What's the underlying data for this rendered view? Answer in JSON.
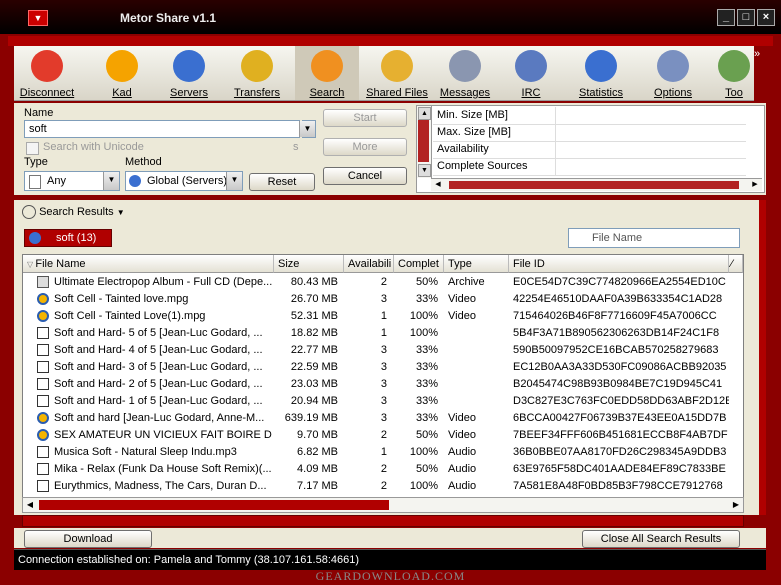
{
  "window": {
    "title": "Metor Share v1.1",
    "minimize": "_",
    "maximize": "□",
    "close": "×",
    "app_icon": "▼"
  },
  "toolbar": {
    "buttons": [
      {
        "label": "Disconnect",
        "icon": "disconnect-icon",
        "color": "#e23b2b"
      },
      {
        "label": "Kad",
        "icon": "kad-icon",
        "color": "#f5a300"
      },
      {
        "label": "Servers",
        "icon": "servers-icon",
        "color": "#3a6fd0"
      },
      {
        "label": "Transfers",
        "icon": "transfers-icon",
        "color": "#e0b020"
      },
      {
        "label": "Search",
        "icon": "search-icon",
        "color": "#f09020"
      },
      {
        "label": "Shared Files",
        "icon": "shared-files-icon",
        "color": "#e6b030"
      },
      {
        "label": "Messages",
        "icon": "messages-icon",
        "color": "#8a96b0"
      },
      {
        "label": "IRC",
        "icon": "irc-icon",
        "color": "#5a7ac0"
      },
      {
        "label": "Statistics",
        "icon": "statistics-icon",
        "color": "#3a6fd0"
      },
      {
        "label": "Options",
        "icon": "options-icon",
        "color": "#7a90c0"
      },
      {
        "label": "Too",
        "icon": "tools-icon",
        "color": "#6aa050"
      }
    ],
    "more": "»"
  },
  "search": {
    "name_label": "Name",
    "name_value": "soft",
    "unicode_label": "Search with Unicode",
    "unicode_suffix": "s",
    "type_label": "Type",
    "type_value": "Any",
    "method_label": "Method",
    "method_value": "Global (Servers)",
    "start_label": "Start",
    "more_label": "More",
    "cancel_label": "Cancel",
    "reset_label": "Reset"
  },
  "properties": [
    "Min. Size [MB]",
    "Max. Size [MB]",
    "Availability",
    "Complete Sources"
  ],
  "results": {
    "label": "Search Results",
    "tab_label": "soft (13)",
    "filter_placeholder": "File Name",
    "columns": [
      "File Name",
      "Size",
      "Availabili",
      "Complet",
      "Type",
      "File ID"
    ],
    "rows": [
      {
        "name": "Ultimate Electropop Album - Full CD (Depe...",
        "size": "80.43 MB",
        "avail": "2",
        "complete": "50%",
        "type": "Archive",
        "id": "E0CE54D7C39C774820966EA2554ED10C",
        "icon": "archive"
      },
      {
        "name": "Soft Cell - Tainted love.mpg",
        "size": "26.70 MB",
        "avail": "3",
        "complete": "33%",
        "type": "Video",
        "id": "42254E46510DAAF0A39B633354C1AD28",
        "icon": "video"
      },
      {
        "name": "Soft Cell - Tainted Love(1).mpg",
        "size": "52.31 MB",
        "avail": "1",
        "complete": "100%",
        "type": "Video",
        "id": "715464026B46F8F7716609F45A7006CC",
        "icon": "video"
      },
      {
        "name": "Soft and Hard- 5 of 5 [Jean-Luc Godard, ...",
        "size": "18.82 MB",
        "avail": "1",
        "complete": "100%",
        "type": "",
        "id": "5B4F3A71B890562306263DB14F24C1F8",
        "icon": "unknown"
      },
      {
        "name": "Soft and Hard- 4 of 5 [Jean-Luc Godard, ...",
        "size": "22.77 MB",
        "avail": "3",
        "complete": "33%",
        "type": "",
        "id": "590B50097952CE16BCAB570258279683",
        "icon": "unknown"
      },
      {
        "name": "Soft and Hard- 3 of 5 [Jean-Luc Godard, ...",
        "size": "22.59 MB",
        "avail": "3",
        "complete": "33%",
        "type": "",
        "id": "EC12B0AA3A33D530FC09086ACBB92035",
        "icon": "unknown"
      },
      {
        "name": "Soft and Hard- 2 of 5 [Jean-Luc Godard, ...",
        "size": "23.03 MB",
        "avail": "3",
        "complete": "33%",
        "type": "",
        "id": "B2045474C98B93B0984BE7C19D945C41",
        "icon": "unknown"
      },
      {
        "name": "Soft and Hard- 1 of 5 [Jean-Luc Godard, ...",
        "size": "20.94 MB",
        "avail": "3",
        "complete": "33%",
        "type": "",
        "id": "D3C827E3C763FC0EDD58DD63ABF2D12E",
        "icon": "unknown"
      },
      {
        "name": "Soft and hard [Jean-Luc Godard, Anne-M...",
        "size": "639.19 MB",
        "avail": "3",
        "complete": "33%",
        "type": "Video",
        "id": "6BCCA00427F06739B37E43EE0A15DD7B",
        "icon": "video"
      },
      {
        "name": "SEX AMATEUR UN VICIEUX FAIT BOIRE D...",
        "size": "9.70 MB",
        "avail": "2",
        "complete": "50%",
        "type": "Video",
        "id": "7BEEF34FFF606B451681ECCB8F4AB7DF",
        "icon": "video"
      },
      {
        "name": "Musica Soft - Natural Sleep Indu.mp3",
        "size": "6.82 MB",
        "avail": "1",
        "complete": "100%",
        "type": "Audio",
        "id": "36B0BBE07AA8170FD26C298345A9DDB3",
        "icon": "audio"
      },
      {
        "name": "Mika - Relax (Funk Da House Soft Remix)(...",
        "size": "4.09 MB",
        "avail": "2",
        "complete": "50%",
        "type": "Audio",
        "id": "63E9765F58DC401AADE84EF89C7833BE",
        "icon": "audio"
      },
      {
        "name": "Eurythmics, Madness, The Cars, Duran D...",
        "size": "7.17 MB",
        "avail": "2",
        "complete": "100%",
        "type": "Audio",
        "id": "7A581E8A48F0BD85B3F798CCE7912768",
        "icon": "audio"
      }
    ]
  },
  "bottom": {
    "download_label": "Download",
    "close_all_label": "Close All Search Results"
  },
  "status": {
    "text": "Connection established on: Pamela and Tommy (38.107.161.58:4661)"
  },
  "watermark": "GEARDOWNLOAD.COM"
}
